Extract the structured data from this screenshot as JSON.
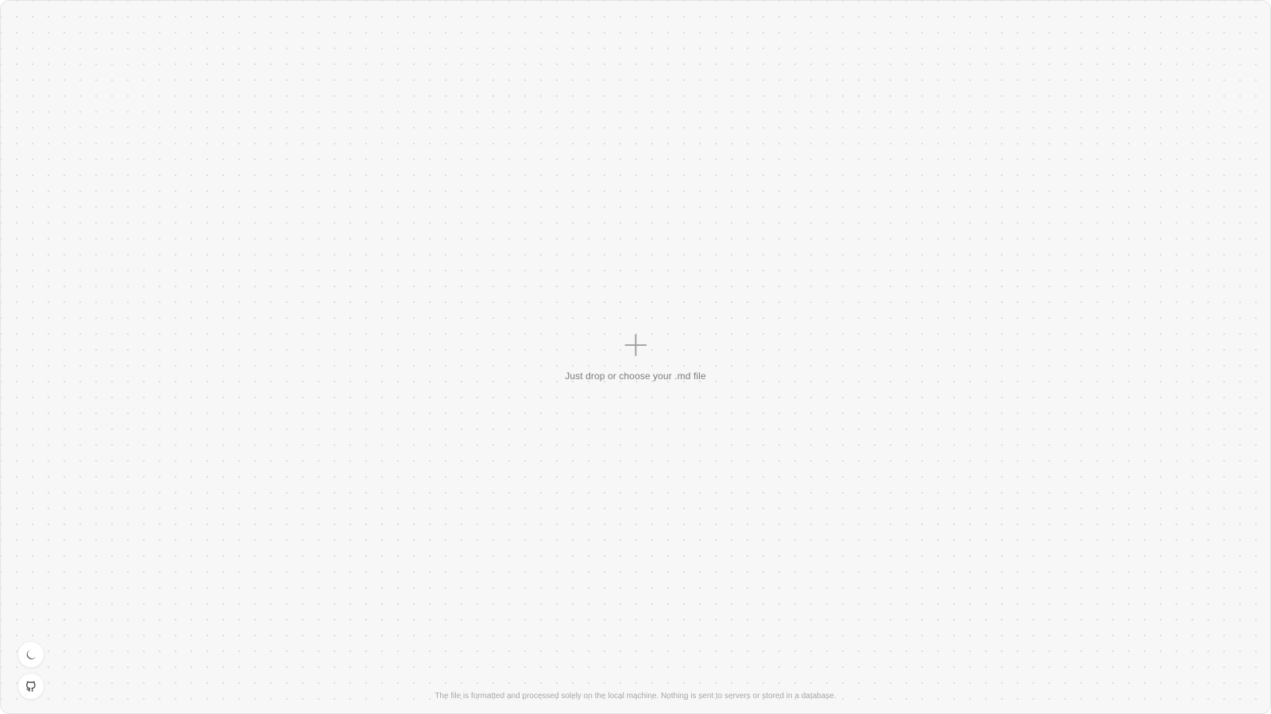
{
  "dropzone": {
    "icon": "plus-icon",
    "label": "Just drop or choose your .md file"
  },
  "controls": {
    "theme_toggle_icon": "moon-icon",
    "github_icon": "github-icon"
  },
  "footer": {
    "note": "The file is formatted and processed solely on the local machine. Nothing is sent to servers or stored in a database."
  },
  "colors": {
    "background": "#f7f7f7",
    "dot_grid": "#d9d9d9",
    "label_text": "#7b7b7b",
    "footer_text": "#a6a6a6",
    "icon": "#9a9a9a"
  }
}
